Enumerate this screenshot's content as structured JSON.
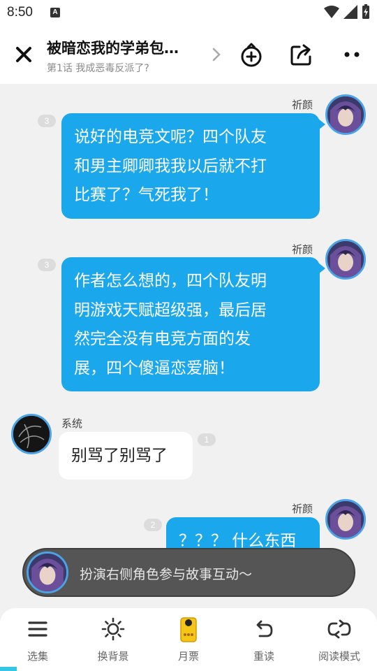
{
  "status_bar": {
    "time": "8:50",
    "notification_icon": "A"
  },
  "header": {
    "title": "被暗恋我的学弟包…",
    "subtitle": "第1话 我成恶毒反派了?",
    "icons": [
      "close-icon",
      "chevron-right-icon",
      "add-character-icon",
      "share-icon",
      "more-icon"
    ]
  },
  "messages": [
    {
      "sender": "祈颜",
      "side": "right",
      "badge": "3",
      "text": [
        "说好的电竞文呢？四个队友",
        "和男主卿卿我我以后就不打",
        "比赛了？气死我了！"
      ]
    },
    {
      "sender": "祈颜",
      "side": "right",
      "badge": "3",
      "text": [
        "作者怎么想的，四个队友明",
        "明游戏天赋超级强，最后居",
        "然完全没有电竞方面的发",
        "展，四个傻逼恋爱脑！"
      ]
    },
    {
      "sender": "系统",
      "side": "left",
      "badge": "1",
      "text": [
        "别骂了别骂了"
      ]
    },
    {
      "sender": "祈颜",
      "side": "right",
      "badge": "2",
      "text": [
        "？？？ 什么东西"
      ]
    }
  ],
  "roleplay_prompt": "扮演右侧角色参与故事互动～",
  "bottom_nav": [
    {
      "label": "选集",
      "icon": "list-icon"
    },
    {
      "label": "换背景",
      "icon": "sun-icon"
    },
    {
      "label": "月票",
      "icon": "ticket-icon"
    },
    {
      "label": "重读",
      "icon": "replay-icon"
    },
    {
      "label": "阅读模式",
      "icon": "loop-icon"
    }
  ],
  "colors": {
    "bubble_me": "#1aa7ec",
    "avatar_ring": "#4aa3e6",
    "accent": "#35c6e6"
  }
}
